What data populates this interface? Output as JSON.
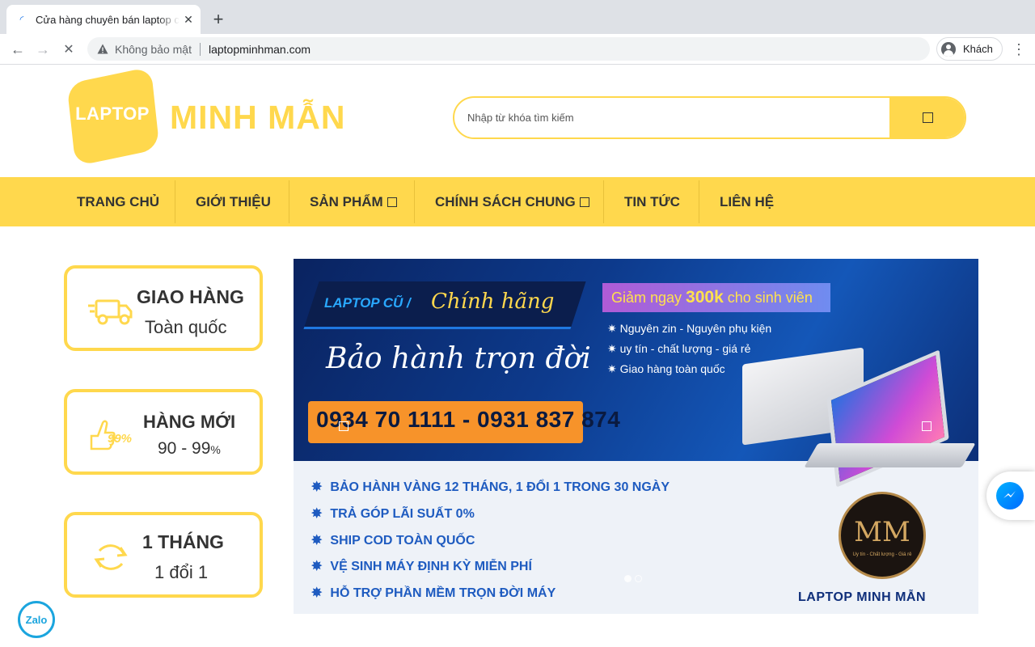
{
  "browser": {
    "tab_title": "Cửa hàng chuyên bán laptop cũ",
    "tab_close": "✕",
    "new_tab": "+",
    "back": "←",
    "forward": "→",
    "reload": "✕",
    "security_label": "Không bảo mật",
    "url": "laptopminhman.com",
    "profile_name": "Khách",
    "menu": "⋮"
  },
  "header": {
    "logo_badge_text": "LAPTOP",
    "logo_name": "MINH MẪN",
    "search_placeholder": "Nhập từ khóa tìm kiếm"
  },
  "nav": {
    "items": [
      {
        "label": "TRANG CHỦ",
        "has_dropdown": false
      },
      {
        "label": "GIỚI THIỆU",
        "has_dropdown": false
      },
      {
        "label": "SẢN PHẨM",
        "has_dropdown": true
      },
      {
        "label": "CHÍNH SÁCH CHUNG",
        "has_dropdown": true
      },
      {
        "label": "TIN TỨC",
        "has_dropdown": false
      },
      {
        "label": "LIÊN HỆ",
        "has_dropdown": false
      }
    ]
  },
  "features": [
    {
      "icon": "truck-icon",
      "title": "GIAO HÀNG",
      "subtitle": "Toàn quốc"
    },
    {
      "icon": "thumbs-up-99-icon",
      "icon_text": "99%",
      "title": "HÀNG MỚI",
      "subtitle_main": "90 - 99",
      "subtitle_unit": "%"
    },
    {
      "icon": "refresh-arrows-icon",
      "title": "1 THÁNG",
      "subtitle": "1 đổi 1"
    }
  ],
  "banner": {
    "tag_left": "LAPTOP CŨ /",
    "tag_right": "Chính hãng",
    "warranty": "Bảo hành trọn đời",
    "phone": "0934 70 1111 - 0931 837 874",
    "promo_before": "Giảm ngay ",
    "promo_amount": "300k",
    "promo_after": " cho sinh viên",
    "bullets": [
      "Nguyên zin - Nguyên phụ kiện",
      "uy tín - chất lượng - giá rẻ",
      "Giao hàng toàn quốc"
    ],
    "features": [
      "BẢO HÀNH VÀNG 12 THÁNG, 1 ĐỔI 1 TRONG 30 NGÀY",
      "TRẢ GÓP LÃI SUẤT 0%",
      "SHIP COD TOÀN QUỐC",
      "VỆ SINH MÁY ĐỊNH KỲ MIỄN PHÍ",
      "HỖ TRỢ PHẦN MỀM TRỌN ĐỜI MÁY"
    ],
    "mm_logo": "MM",
    "mm_tagline": "Uy tín - Chất lượng - Giá rẻ",
    "brand": "LAPTOP MINH MẪN",
    "active_slide": 1,
    "slide_count": 2
  },
  "floating": {
    "zalo_label": "Zalo",
    "messenger_icon": "messenger-icon"
  },
  "colors": {
    "brand_yellow": "#ffd84d",
    "text_dark": "#333333",
    "banner_blue": "#0d3a8c",
    "banner_orange": "#f7932a"
  }
}
